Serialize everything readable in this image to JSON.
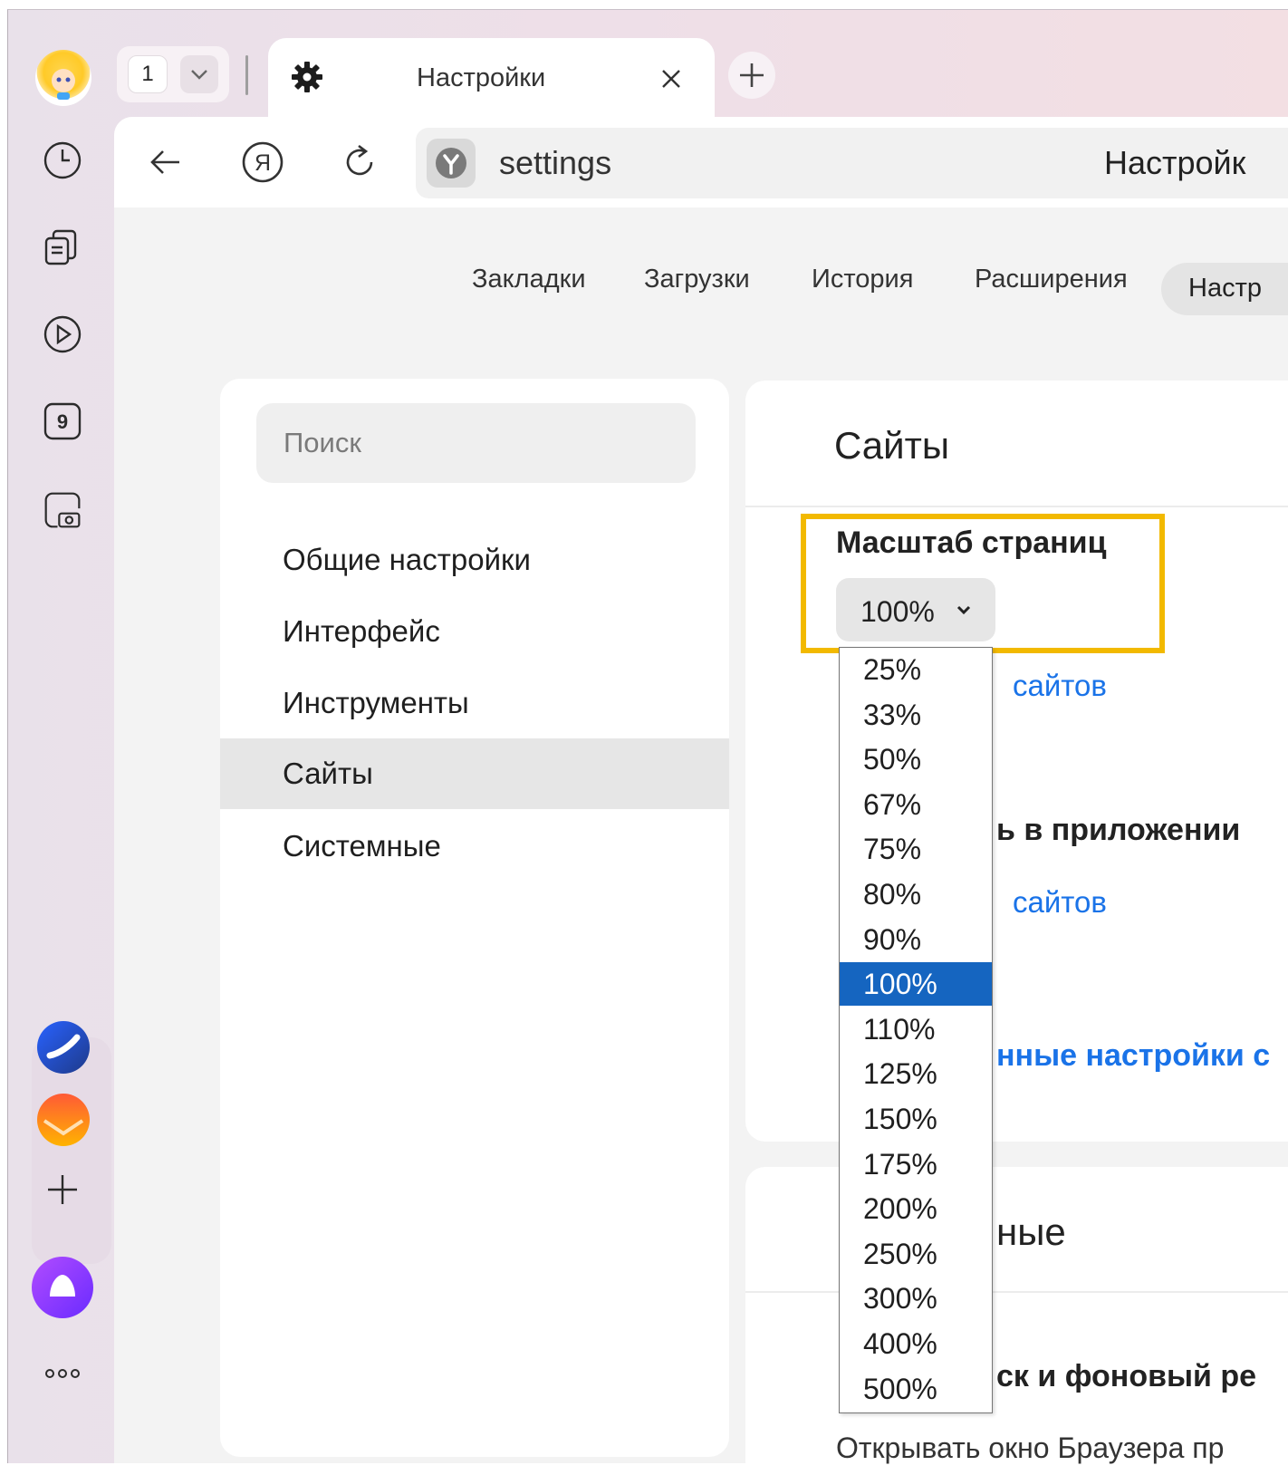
{
  "tabs": {
    "count": "1",
    "active_title": "Настройки"
  },
  "address": {
    "url": "settings",
    "page_title": "Настройк"
  },
  "top_nav": [
    "Закладки",
    "Загрузки",
    "История",
    "Расширения",
    "Настр"
  ],
  "search": {
    "placeholder": "Поиск"
  },
  "nav_items": [
    "Общие настройки",
    "Интерфейс",
    "Инструменты",
    "Сайты",
    "Системные"
  ],
  "active_nav": "Сайты",
  "section": {
    "title": "Сайты",
    "zoom_label": "Масштаб страниц",
    "zoom_value": "100%",
    "link1": "сайтов",
    "heading2": "ь в приложении",
    "link2": "сайтов",
    "link3": "нные настройки с",
    "section2_title": "ные",
    "heading3": "ск и фоновый ре",
    "footer_text": "Открывать окно Браузера пр"
  },
  "zoom_options": [
    "25%",
    "33%",
    "50%",
    "67%",
    "75%",
    "80%",
    "90%",
    "100%",
    "110%",
    "125%",
    "150%",
    "175%",
    "200%",
    "250%",
    "300%",
    "400%",
    "500%"
  ],
  "zoom_selected": "100%",
  "colors": {
    "highlight_frame": "#f2b900",
    "selected_option": "#1565c0",
    "link": "#1a73e8"
  }
}
